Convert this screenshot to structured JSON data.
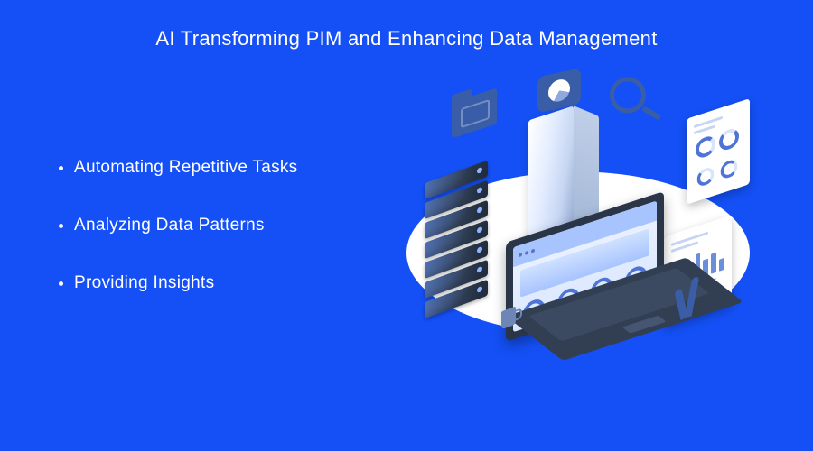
{
  "title": "AI Transforming PIM and Enhancing Data Management",
  "bullets": [
    "Automating Repetitive Tasks",
    "Analyzing Data Patterns",
    "Providing Insights"
  ]
}
